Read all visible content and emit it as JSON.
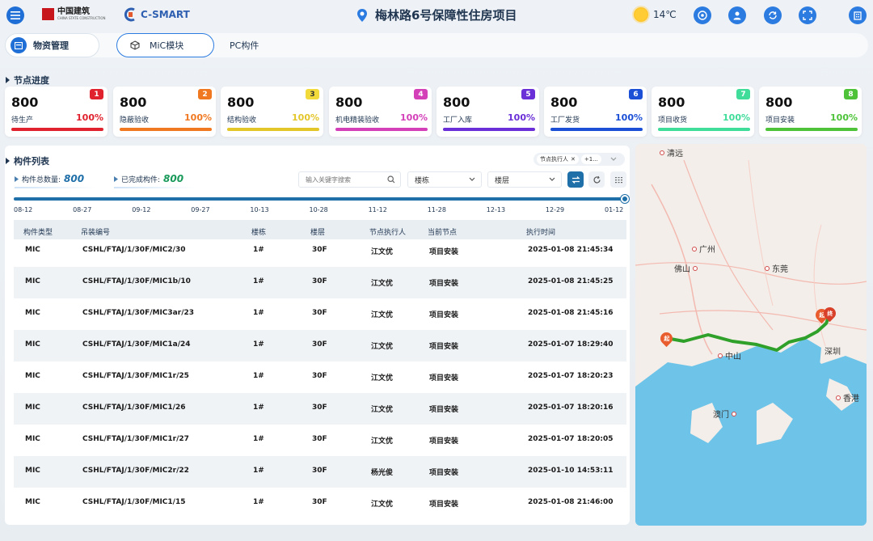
{
  "header": {
    "logo_cscec_cn": "中国建筑",
    "logo_cscec_en": "CHINA STATE CONSTRUCTION",
    "logo_csmart": "C-SMART",
    "project_title": "梅林路6号保障性住房项目",
    "temperature": "14℃"
  },
  "tabs": {
    "main": "物资管理",
    "mic": "MiC模块",
    "pc": "PC构件"
  },
  "progress": {
    "title": "节点进度",
    "cards": [
      {
        "value": "800",
        "label": "待生产",
        "percent": "100%",
        "badge": "1",
        "color": "#e0222e",
        "badge_bg": "#e0222e",
        "badge_fg": "#ffffff"
      },
      {
        "value": "800",
        "label": "隐蔽验收",
        "percent": "100%",
        "badge": "2",
        "color": "#f07820",
        "badge_bg": "#f07820",
        "badge_fg": "#ffffff"
      },
      {
        "value": "800",
        "label": "结构验收",
        "percent": "100%",
        "badge": "3",
        "color": "#e3c62a",
        "badge_bg": "#f2da3a",
        "badge_fg": "#333333"
      },
      {
        "value": "800",
        "label": "机电精装验收",
        "percent": "100%",
        "badge": "4",
        "color": "#d340b8",
        "badge_bg": "#d340b8",
        "badge_fg": "#ffffff"
      },
      {
        "value": "800",
        "label": "工厂入库",
        "percent": "100%",
        "badge": "5",
        "color": "#6a2fd6",
        "badge_bg": "#6a2fd6",
        "badge_fg": "#ffffff"
      },
      {
        "value": "800",
        "label": "工厂发货",
        "percent": "100%",
        "badge": "6",
        "color": "#1a4fd6",
        "badge_bg": "#1a4fd6",
        "badge_fg": "#ffffff"
      },
      {
        "value": "800",
        "label": "项目收货",
        "percent": "100%",
        "badge": "7",
        "color": "#3fdc9a",
        "badge_bg": "#3fdc9a",
        "badge_fg": "#ffffff"
      },
      {
        "value": "800",
        "label": "项目安装",
        "percent": "100%",
        "badge": "8",
        "color": "#4ec33a",
        "badge_bg": "#4ec33a",
        "badge_fg": "#ffffff"
      }
    ]
  },
  "list": {
    "title": "构件列表",
    "total_label": "构件总数量:",
    "total_value": "800",
    "done_label": "已完成构件:",
    "done_value": "800",
    "filter_chip": "节点执行人",
    "filter_more": "+1...",
    "search_placeholder": "输入关键字搜索",
    "building_select": "楼栋",
    "floor_select": "楼层",
    "timeline_labels": [
      "08-12",
      "08-27",
      "09-12",
      "09-27",
      "10-13",
      "10-28",
      "11-12",
      "11-28",
      "12-13",
      "12-29",
      "01-12"
    ],
    "columns": [
      "构件类型",
      "吊装编号",
      "楼栋",
      "楼层",
      "节点执行人",
      "当前节点",
      "执行时间"
    ],
    "rows": [
      {
        "type": "MIC",
        "code": "CSHL/FTAJ/1/30F/MIC2/30",
        "building": "1#",
        "floor": "30F",
        "executor": "江文优",
        "node": "项目安装",
        "time": "2025-01-08 21:45:34"
      },
      {
        "type": "MIC",
        "code": "CSHL/FTAJ/1/30F/MIC1b/10",
        "building": "1#",
        "floor": "30F",
        "executor": "江文优",
        "node": "项目安装",
        "time": "2025-01-08 21:45:25"
      },
      {
        "type": "MIC",
        "code": "CSHL/FTAJ/1/30F/MIC3ar/23",
        "building": "1#",
        "floor": "30F",
        "executor": "江文优",
        "node": "项目安装",
        "time": "2025-01-08 21:45:16"
      },
      {
        "type": "MIC",
        "code": "CSHL/FTAJ/1/30F/MIC1a/24",
        "building": "1#",
        "floor": "30F",
        "executor": "江文优",
        "node": "项目安装",
        "time": "2025-01-07 18:29:40"
      },
      {
        "type": "MIC",
        "code": "CSHL/FTAJ/1/30F/MIC1r/25",
        "building": "1#",
        "floor": "30F",
        "executor": "江文优",
        "node": "项目安装",
        "time": "2025-01-07 18:20:23"
      },
      {
        "type": "MIC",
        "code": "CSHL/FTAJ/1/30F/MIC1/26",
        "building": "1#",
        "floor": "30F",
        "executor": "江文优",
        "node": "项目安装",
        "time": "2025-01-07 18:20:16"
      },
      {
        "type": "MIC",
        "code": "CSHL/FTAJ/1/30F/MIC1r/27",
        "building": "1#",
        "floor": "30F",
        "executor": "江文优",
        "node": "项目安装",
        "time": "2025-01-07 18:20:05"
      },
      {
        "type": "MIC",
        "code": "CSHL/FTAJ/1/30F/MIC2r/22",
        "building": "1#",
        "floor": "30F",
        "executor": "杨光俊",
        "node": "项目安装",
        "time": "2025-01-10 14:53:11"
      },
      {
        "type": "MIC",
        "code": "CSHL/FTAJ/1/30F/MIC1/15",
        "building": "1#",
        "floor": "30F",
        "executor": "江文优",
        "node": "项目安装",
        "time": "2025-01-08 21:46:00"
      }
    ]
  },
  "map": {
    "cities": [
      "清远",
      "广州",
      "佛山",
      "东莞",
      "中山",
      "深圳",
      "香港",
      "澳门"
    ],
    "start_marker": "起",
    "end_marker": "起",
    "end_marker2": "终"
  }
}
